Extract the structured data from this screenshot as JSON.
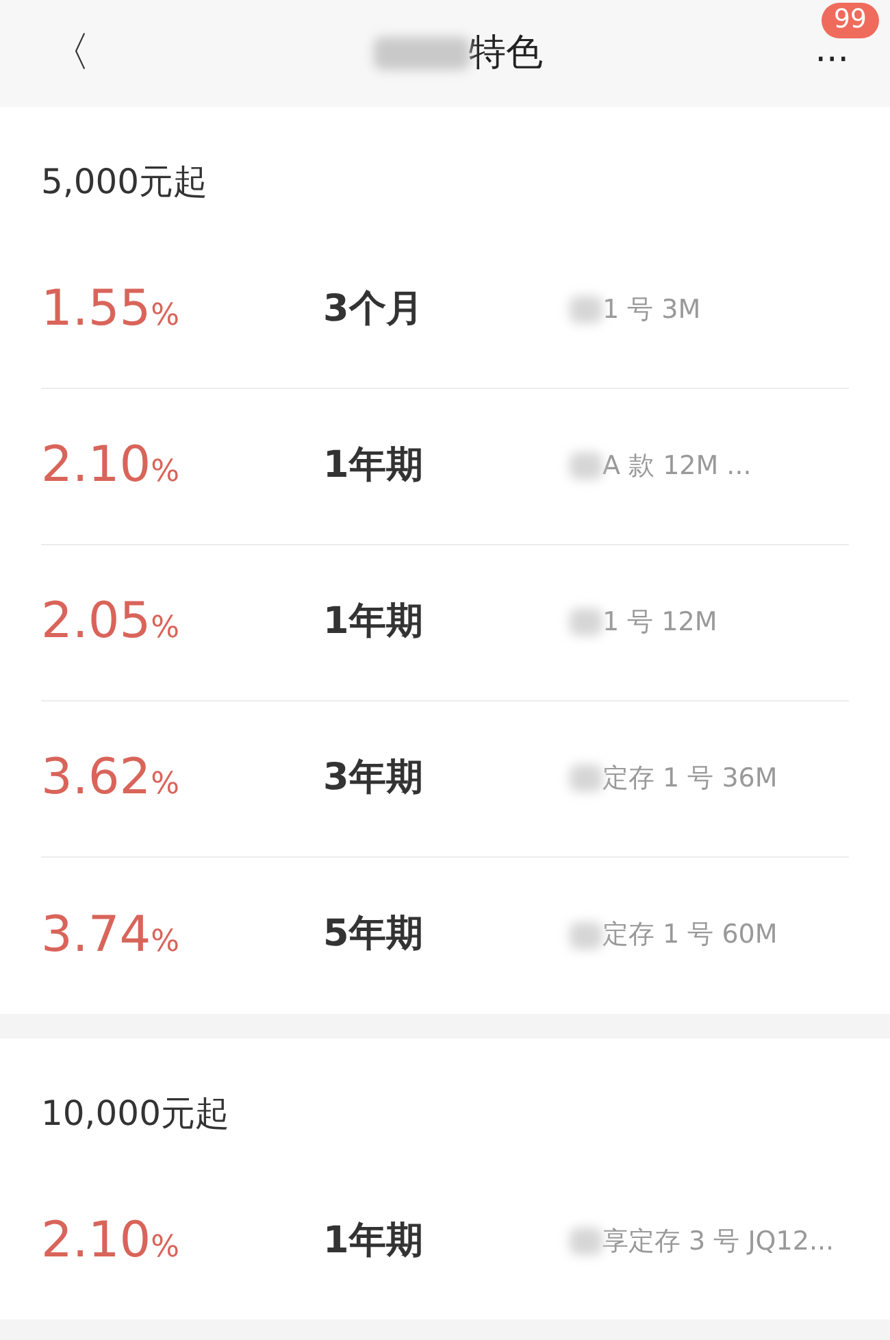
{
  "header": {
    "back": "〈",
    "title": "特色",
    "more": "···",
    "badge": "99"
  },
  "sections": [
    {
      "heading": "5,000元起",
      "rows": [
        {
          "rate": "1.55",
          "unit": "%",
          "term": "3个月",
          "name": "1 号 3M"
        },
        {
          "rate": "2.10",
          "unit": "%",
          "term": "1年期",
          "name": "A 款 12M ..."
        },
        {
          "rate": "2.05",
          "unit": "%",
          "term": "1年期",
          "name": "1 号 12M"
        },
        {
          "rate": "3.62",
          "unit": "%",
          "term": "3年期",
          "name": "定存 1 号 36M"
        },
        {
          "rate": "3.74",
          "unit": "%",
          "term": "5年期",
          "name": "定存 1 号 60M"
        }
      ]
    },
    {
      "heading": "10,000元起",
      "rows": [
        {
          "rate": "2.10",
          "unit": "%",
          "term": "1年期",
          "name": "享定存 3 号 JQ12..."
        }
      ]
    }
  ]
}
